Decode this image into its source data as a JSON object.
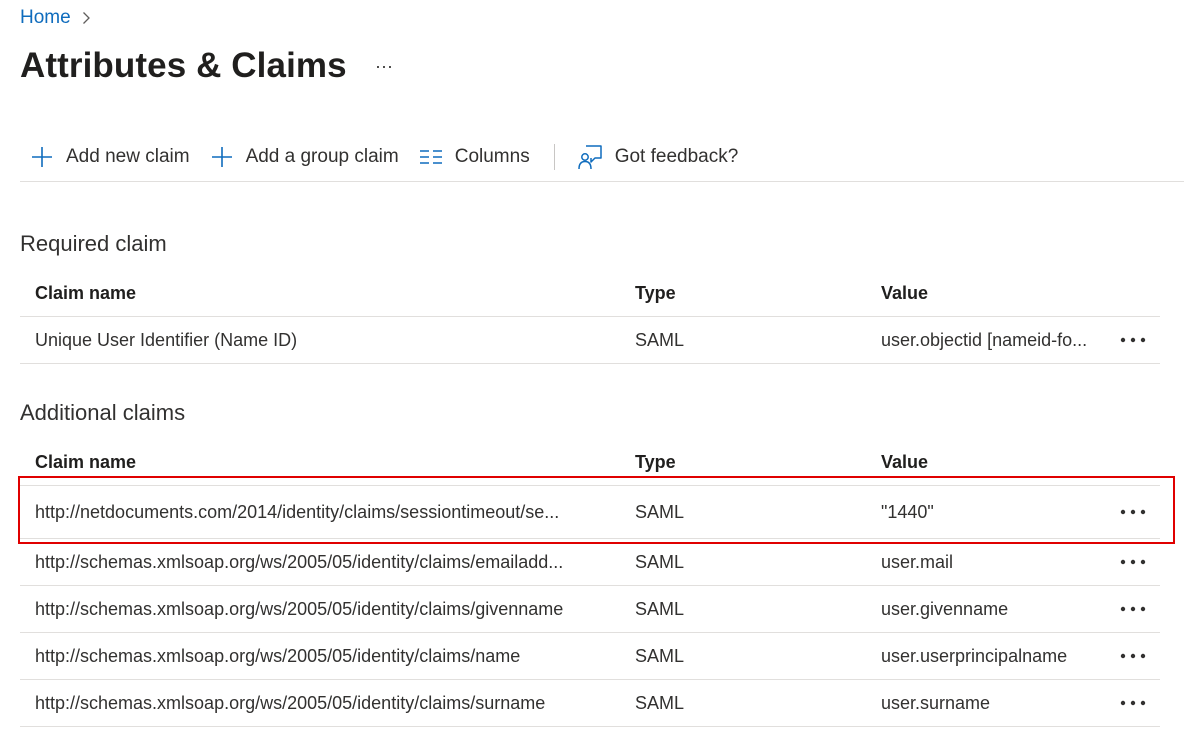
{
  "breadcrumb": {
    "home_label": "Home"
  },
  "page": {
    "title": "Attributes & Claims",
    "more_label": "···"
  },
  "toolbar": {
    "add_new_claim": "Add new claim",
    "add_group_claim": "Add a group claim",
    "columns": "Columns",
    "feedback": "Got feedback?"
  },
  "required_section": {
    "title": "Required claim",
    "headers": {
      "name": "Claim name",
      "type": "Type",
      "value": "Value"
    },
    "rows": [
      {
        "name": "Unique User Identifier (Name ID)",
        "type": "SAML",
        "value": "user.objectid [nameid-fo..."
      }
    ]
  },
  "additional_section": {
    "title": "Additional claims",
    "headers": {
      "name": "Claim name",
      "type": "Type",
      "value": "Value"
    },
    "rows": [
      {
        "name": "http://netdocuments.com/2014/identity/claims/sessiontimeout/se...",
        "type": "SAML",
        "value": "\"1440\"",
        "highlighted": true
      },
      {
        "name": "http://schemas.xmlsoap.org/ws/2005/05/identity/claims/emailadd...",
        "type": "SAML",
        "value": "user.mail"
      },
      {
        "name": "http://schemas.xmlsoap.org/ws/2005/05/identity/claims/givenname",
        "type": "SAML",
        "value": "user.givenname"
      },
      {
        "name": "http://schemas.xmlsoap.org/ws/2005/05/identity/claims/name",
        "type": "SAML",
        "value": "user.userprincipalname"
      },
      {
        "name": "http://schemas.xmlsoap.org/ws/2005/05/identity/claims/surname",
        "type": "SAML",
        "value": "user.surname"
      }
    ]
  },
  "colors": {
    "accent": "#0f6cbd",
    "text": "#323130",
    "border": "#e1dfdd",
    "highlight": "#e00000"
  },
  "icons": {
    "breadcrumb_separator": "chevron-right-icon",
    "add": "plus-icon",
    "columns": "columns-icon",
    "feedback": "feedback-icon",
    "row_menu": "more-horizontal-icon"
  }
}
